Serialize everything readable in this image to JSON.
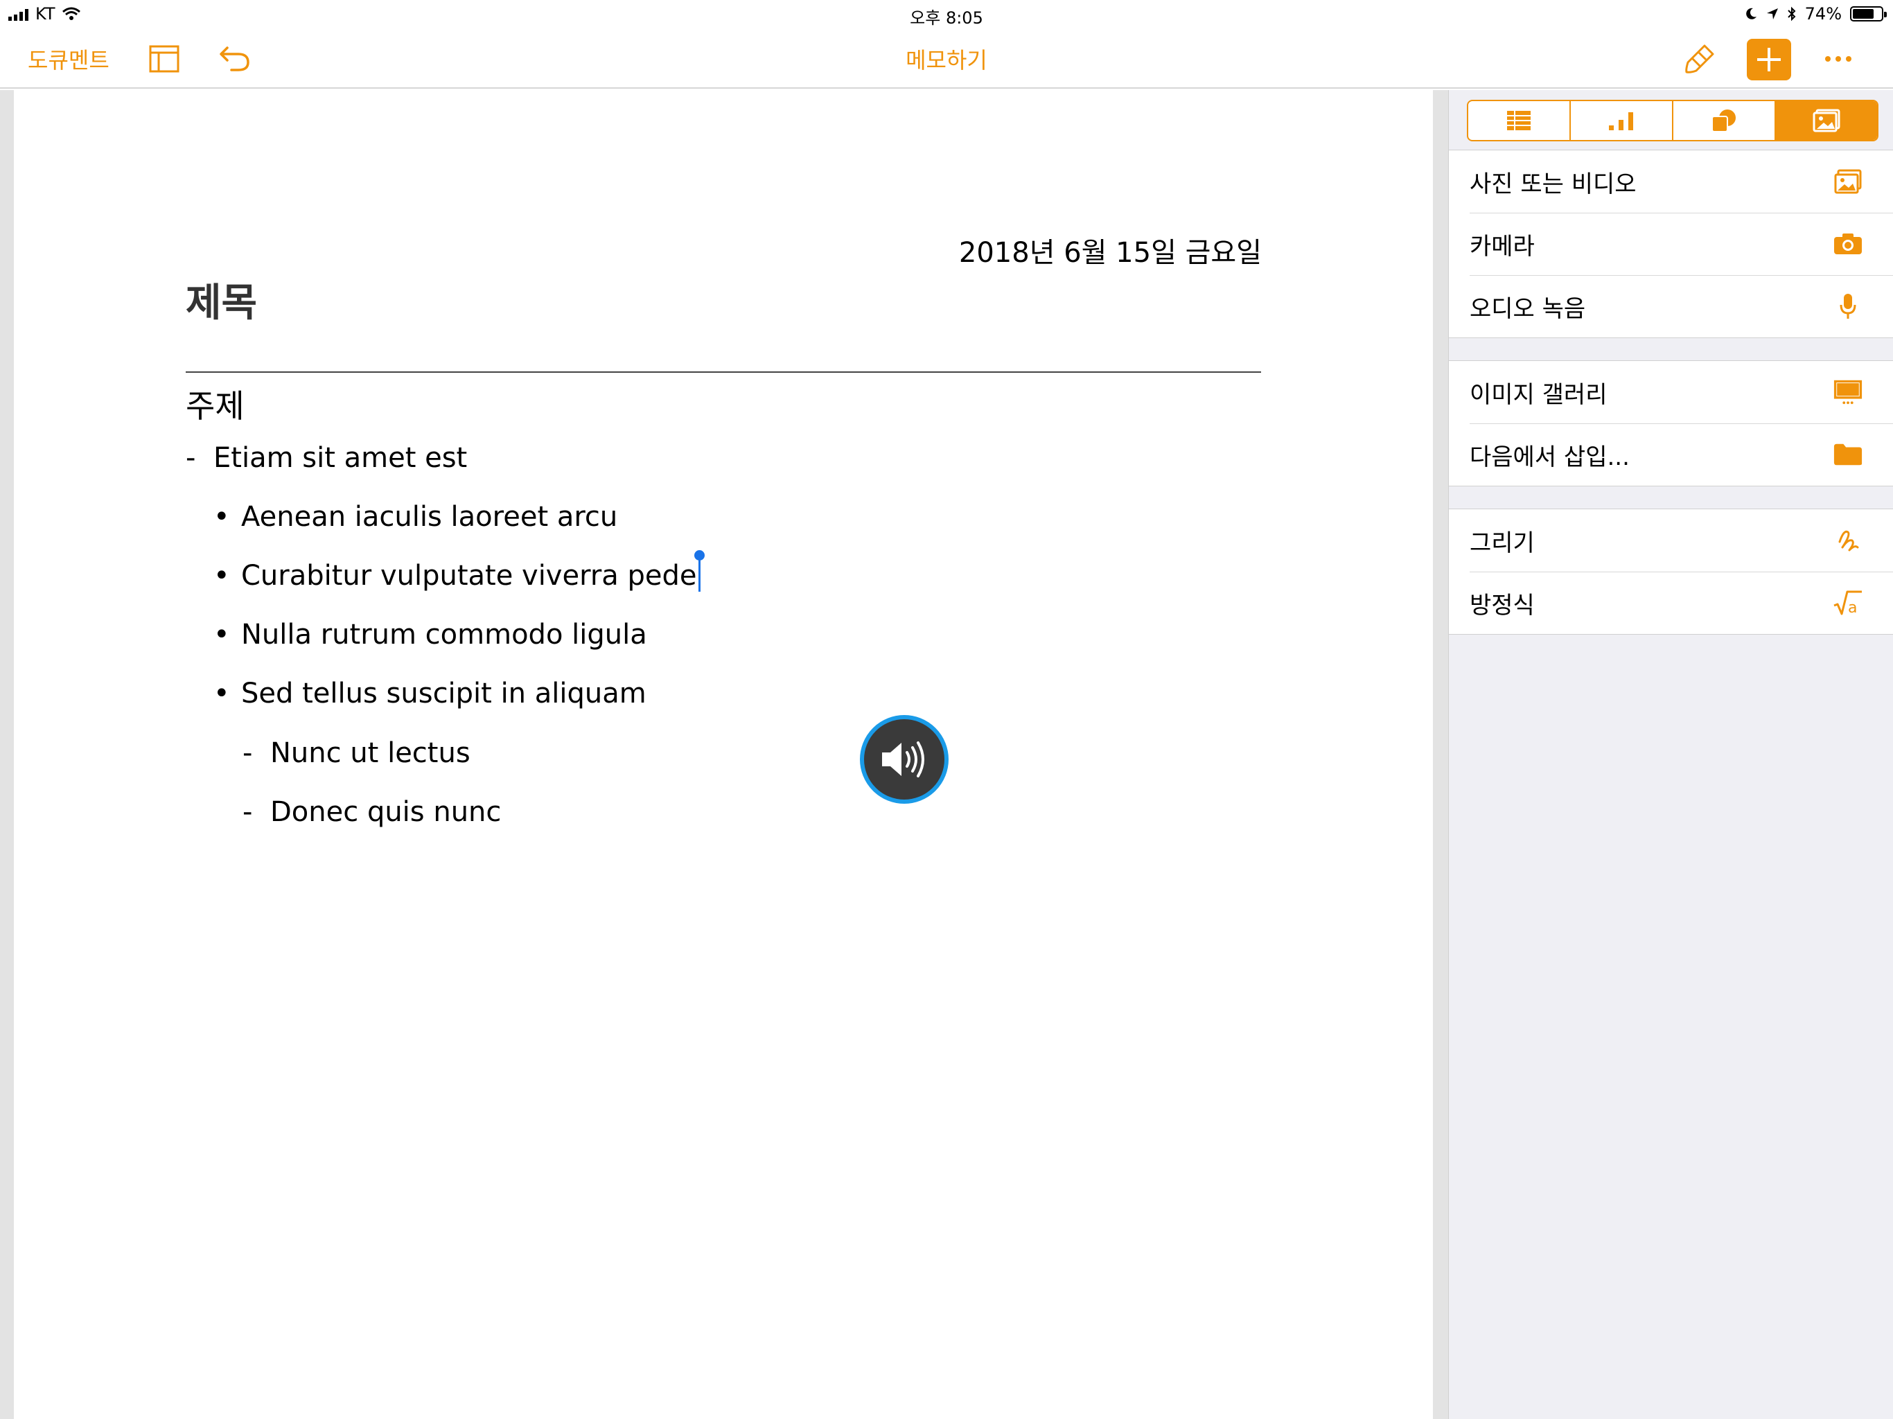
{
  "status_bar": {
    "carrier": "KT",
    "time": "오후 8:05",
    "battery_percent": "74%",
    "battery_level": 0.74
  },
  "toolbar": {
    "documents_label": "도큐멘트",
    "title": "메모하기",
    "accent_color": "#F0930C"
  },
  "document": {
    "date": "2018년 6월 15일 금요일",
    "title": "제목",
    "subject": "주제",
    "list": [
      {
        "marker": "-",
        "text": "Etiam sit amet est"
      },
      {
        "marker": "•",
        "text": "Aenean iaculis laoreet arcu"
      },
      {
        "marker": "•",
        "text": "Curabitur vulputate viverra pede"
      },
      {
        "marker": "•",
        "text": "Nulla rutrum commodo ligula"
      },
      {
        "marker": "•",
        "text": "Sed tellus suscipit in aliquam"
      },
      {
        "marker": "-",
        "text": "Nunc ut lectus"
      },
      {
        "marker": "-",
        "text": "Donec quis nunc"
      }
    ]
  },
  "insert_panel": {
    "tabs": [
      {
        "icon": "table-icon"
      },
      {
        "icon": "chart-icon"
      },
      {
        "icon": "shapes-icon"
      },
      {
        "icon": "media-icon",
        "active": true
      }
    ],
    "groups": [
      [
        {
          "label": "사진 또는 비디오",
          "icon": "photo-icon"
        },
        {
          "label": "카메라",
          "icon": "camera-icon"
        },
        {
          "label": "오디오 녹음",
          "icon": "microphone-icon"
        }
      ],
      [
        {
          "label": "이미지 갤러리",
          "icon": "gallery-icon"
        },
        {
          "label": "다음에서 삽입...",
          "icon": "folder-icon"
        }
      ],
      [
        {
          "label": "그리기",
          "icon": "drawing-icon"
        },
        {
          "label": "방정식",
          "icon": "equation-icon"
        }
      ]
    ]
  }
}
